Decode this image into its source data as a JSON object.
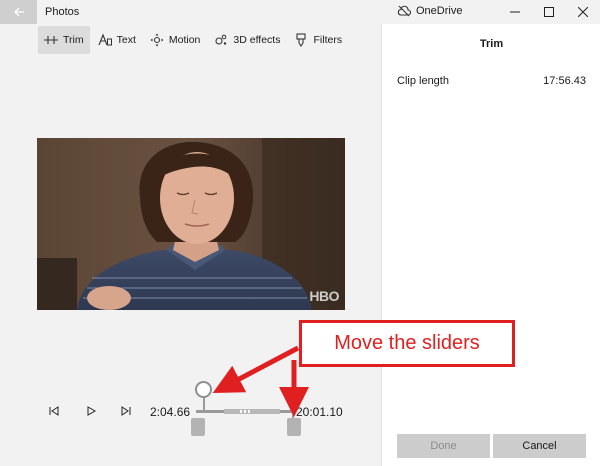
{
  "window": {
    "app_title": "Photos",
    "onedrive_label": "OneDrive"
  },
  "toolbar": {
    "items": [
      {
        "label": "Trim",
        "icon": "trim-icon",
        "active": true
      },
      {
        "label": "Text",
        "icon": "text-icon",
        "active": false
      },
      {
        "label": "Motion",
        "icon": "motion-icon",
        "active": false
      },
      {
        "label": "3D effects",
        "icon": "3d-effects-icon",
        "active": false
      },
      {
        "label": "Filters",
        "icon": "filters-icon",
        "active": false
      }
    ]
  },
  "panel": {
    "title": "Trim",
    "clip_length_label": "Clip length",
    "clip_length_value": "17:56.43",
    "done_label": "Done",
    "cancel_label": "Cancel"
  },
  "video": {
    "watermark": "HBO"
  },
  "playback": {
    "start_time": "2:04.66",
    "end_time": "20:01.10"
  },
  "annotation": {
    "text": "Move the sliders",
    "color": "#e02020"
  }
}
